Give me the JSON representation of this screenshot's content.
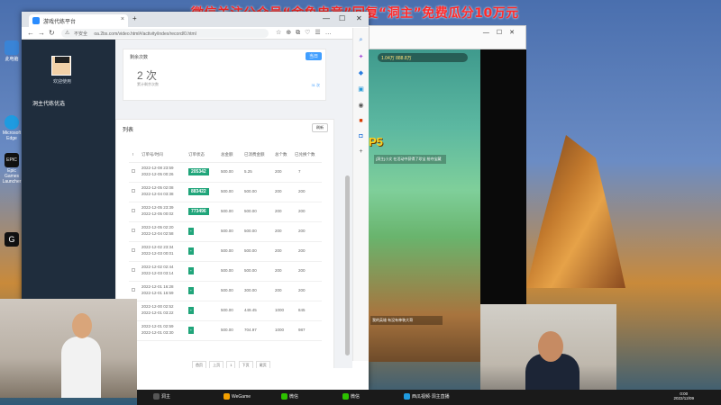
{
  "desktop": {
    "promo_text": "微信关注公众号“金鱼电竞”回复“洞主”免费瓜分10万元",
    "icons": [
      {
        "label": "此电脑"
      },
      {
        "label": "Microsoft Edge"
      },
      {
        "label": "EPIC"
      },
      {
        "label": "Epic Games Launcher"
      },
      {
        "label": "G"
      }
    ]
  },
  "browser": {
    "tab_title": "游戏代练平台",
    "address_insecure": "不安全",
    "url": "oa.2bs.com/video.html#/activity/index/record/0.html"
  },
  "sidebar": {
    "welcome": "欢迎使用",
    "menu_item": "洞主代练优选"
  },
  "stats_card": {
    "label": "剩余次数",
    "badge": "当日",
    "count": "2 次",
    "sub": "累计剩余次数",
    "extra": "31 次"
  },
  "list_card": {
    "title": "列表",
    "refresh": "刷新",
    "headers": [
      "订单号/时间",
      "订单状态",
      "总金额",
      "已消费金额",
      "总个数",
      "已兑换个数"
    ],
    "rows": [
      {
        "time1": "2022-12-08 23:59",
        "time2": "2022-12-05 00:26",
        "status": "205342",
        "total": "500.00",
        "spent": "5.25",
        "count": "200",
        "done": "7"
      },
      {
        "time1": "2022-12-05 02:08",
        "time2": "2022-12-04 03:38",
        "status": "883422",
        "total": "500.00",
        "spent": "500.00",
        "count": "200",
        "done": "200"
      },
      {
        "time1": "2022-12-05 23:39",
        "time2": "2022-12-05 00:02",
        "status": "773496",
        "total": "500.00",
        "spent": "500.00",
        "count": "200",
        "done": "200"
      },
      {
        "time1": "2022-12-05 02:20",
        "time2": "2022-12-04 02:58",
        "status": "-",
        "total": "500.00",
        "spent": "500.00",
        "count": "200",
        "done": "200"
      },
      {
        "time1": "2022-12-02 23:34",
        "time2": "2022-12-03 00:01",
        "status": "-",
        "total": "500.00",
        "spent": "500.00",
        "count": "200",
        "done": "200"
      },
      {
        "time1": "2022-12-02 02:44",
        "time2": "2022-12-03 03:14",
        "status": "-",
        "total": "500.00",
        "spent": "500.00",
        "count": "200",
        "done": "200"
      },
      {
        "time1": "2022-12-01 16:28",
        "time2": "2022-12-01 16:59",
        "status": "-",
        "total": "500.00",
        "spent": "300.00",
        "count": "200",
        "done": "200"
      },
      {
        "time1": "2022-12-00 02:52",
        "time2": "2022-12-01 03:22",
        "status": "-",
        "total": "500.00",
        "spent": "449.45",
        "count": "1000",
        "done": "845"
      },
      {
        "time1": "2022-12-01 02:59",
        "time2": "2022-12-01 03:30",
        "status": "-",
        "total": "500.00",
        "spent": "704.97",
        "count": "1000",
        "done": "987"
      }
    ],
    "pager": [
      "首页",
      "上页",
      "1",
      "下页",
      "尾页"
    ]
  },
  "game": {
    "hud": "1.04万    888.8万",
    "badge": "P5",
    "chat": "[洞主]小文 在活动中获得了珍宝 抢夺宝藏",
    "bottom": "我的英雄 有没有神装大哥"
  },
  "taskbar": {
    "items": [
      "洞主",
      "WeGame",
      "微信",
      "微信",
      "西瓜视频·洞主直播"
    ],
    "time": "0:00",
    "date": "2022/12/09"
  },
  "colors": {
    "accent": "#409eff",
    "tag_green": "#20a57a",
    "sidebar_bg": "#1f2d3d",
    "promo_red": "#ff2a2a"
  }
}
